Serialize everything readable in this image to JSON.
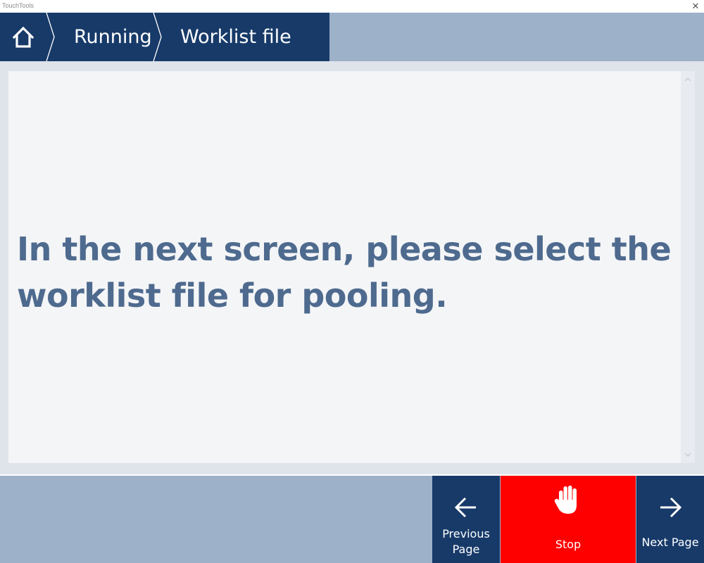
{
  "window": {
    "title": "TouchTools",
    "close_glyph": "✕"
  },
  "breadcrumb": {
    "home_icon": "home-icon",
    "items": [
      {
        "label": "Running"
      },
      {
        "label": "Worklist file"
      }
    ]
  },
  "main": {
    "message": "In the next screen, please select the worklist file for pooling."
  },
  "footer": {
    "previous": {
      "label": "Previous Page",
      "icon": "arrow-left-icon"
    },
    "stop": {
      "label": "Stop",
      "icon": "hand-stop-icon"
    },
    "next": {
      "label": "Next Page",
      "icon": "arrow-right-icon"
    }
  },
  "colors": {
    "navy": "#173a69",
    "header_bg": "#9db1c8",
    "page_bg": "#dfe3ea",
    "panel_bg": "#f4f5f7",
    "message_text": "#4e6a8e",
    "stop_red": "#ff0000"
  }
}
